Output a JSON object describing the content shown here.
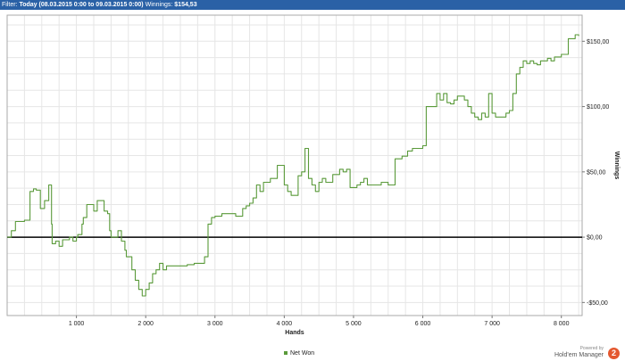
{
  "header": {
    "filter_label": "Filter:",
    "filter_value": "Today (08.03.2015 0:00 to 09.03.2015 0:00)",
    "winnings_label": "Winnings:",
    "winnings_value": "$154,53"
  },
  "branding": {
    "powered_by": "Powered by",
    "product": "Hold'em Manager",
    "badge": "2"
  },
  "colors": {
    "title_bar": "#2a61a6",
    "series_line": "#5a9a3a",
    "zero_line": "#000000",
    "grid": "#e3e3e3"
  },
  "chart_data": {
    "type": "line",
    "xlabel": "Hands",
    "ylabel": "Winnings",
    "xlim": [
      0,
      8300
    ],
    "ylim": [
      -60,
      170
    ],
    "x_ticks": [
      1000,
      2000,
      3000,
      4000,
      5000,
      6000,
      7000,
      8000
    ],
    "x_tick_labels": [
      "1 000",
      "2 000",
      "3 000",
      "4 000",
      "5 000",
      "6 000",
      "7 000",
      "8 000"
    ],
    "y_ticks": [
      -50,
      0,
      50,
      100,
      150
    ],
    "y_tick_labels": [
      "-$50,00",
      "$0,00",
      "$50,00",
      "$100,00",
      "$150,00"
    ],
    "grid": true,
    "legend_position": "bottom-center",
    "series": [
      {
        "name": "Net Won",
        "color": "#5a9a3a",
        "x": [
          0,
          60,
          120,
          250,
          330,
          380,
          420,
          480,
          540,
          600,
          640,
          650,
          700,
          750,
          800,
          900,
          950,
          1000,
          1020,
          1080,
          1100,
          1150,
          1250,
          1300,
          1400,
          1450,
          1480,
          1500,
          1550,
          1600,
          1650,
          1700,
          1720,
          1800,
          1850,
          1900,
          1950,
          2000,
          2050,
          2100,
          2150,
          2200,
          2250,
          2300,
          2400,
          2500,
          2600,
          2700,
          2800,
          2850,
          2900,
          2950,
          3000,
          3100,
          3200,
          3300,
          3400,
          3450,
          3500,
          3550,
          3600,
          3650,
          3700,
          3800,
          3900,
          4000,
          4050,
          4100,
          4200,
          4250,
          4300,
          4350,
          4400,
          4450,
          4500,
          4550,
          4600,
          4700,
          4800,
          4850,
          4900,
          4950,
          5000,
          5050,
          5100,
          5150,
          5200,
          5300,
          5400,
          5500,
          5600,
          5700,
          5750,
          5780,
          5850,
          5950,
          6000,
          6050,
          6100,
          6150,
          6200,
          6250,
          6300,
          6350,
          6400,
          6450,
          6500,
          6600,
          6650,
          6700,
          6750,
          6800,
          6850,
          6900,
          6950,
          7000,
          7050,
          7100,
          7200,
          7250,
          7300,
          7350,
          7400,
          7450,
          7500,
          7550,
          7600,
          7650,
          7700,
          7800,
          7850,
          7900,
          8000,
          8100,
          8150,
          8200,
          8250
        ],
        "y": [
          0,
          5,
          12,
          13,
          35,
          37,
          36,
          22,
          28,
          40,
          10,
          -5,
          -3,
          -7,
          -2,
          0,
          -3,
          0,
          2,
          10,
          15,
          25,
          20,
          28,
          20,
          18,
          5,
          0,
          0,
          5,
          -3,
          -10,
          -15,
          -25,
          -33,
          -40,
          -45,
          -40,
          -35,
          -28,
          -25,
          -20,
          -25,
          -22,
          -22,
          -22,
          -21,
          -20,
          -20,
          -15,
          10,
          15,
          16,
          18,
          18,
          16,
          22,
          24,
          26,
          30,
          40,
          35,
          42,
          45,
          55,
          40,
          35,
          32,
          47,
          50,
          68,
          45,
          40,
          35,
          42,
          45,
          42,
          48,
          52,
          50,
          52,
          38,
          38,
          40,
          42,
          45,
          40,
          40,
          42,
          40,
          60,
          62,
          62,
          66,
          68,
          68,
          70,
          100,
          100,
          100,
          110,
          105,
          110,
          103,
          102,
          105,
          108,
          105,
          100,
          95,
          92,
          90,
          95,
          92,
          110,
          95,
          92,
          92,
          95,
          97,
          110,
          125,
          130,
          135,
          133,
          135,
          133,
          132,
          135,
          137,
          135,
          138,
          140,
          152,
          152,
          155,
          154
        ]
      }
    ]
  }
}
